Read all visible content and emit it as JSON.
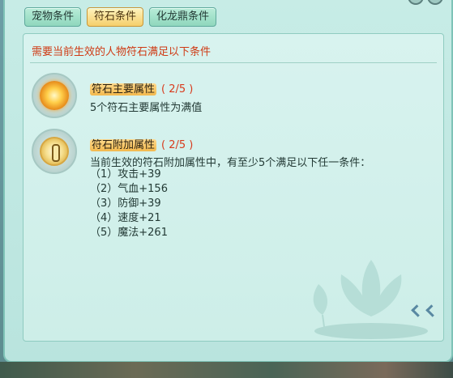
{
  "tabs": [
    {
      "label": "宠物条件",
      "active": false
    },
    {
      "label": "符石条件",
      "active": true
    },
    {
      "label": "化龙鼎条件",
      "active": false
    }
  ],
  "header": {
    "text": "需要当前生效的人物符石满足以下条件"
  },
  "conditions": [
    {
      "icon": "sun-rune-icon",
      "title": "符石主要属性",
      "progress": "( 2/5 )",
      "description": "5个符石主要属性为满值"
    },
    {
      "icon": "shield-rune-icon",
      "title": "符石附加属性",
      "progress": "( 2/5 )",
      "description": "当前生效的符石附加属性中，有至少5个满足以下任一条件：",
      "items": [
        "（1）攻击+39",
        "（2）气血+156",
        "（3）防御+39",
        "（4）速度+21",
        "（5）魔法+261"
      ]
    }
  ],
  "colors": {
    "accent": "#cf3a14",
    "count": "#d83a1c",
    "highlight": "#f3b94e",
    "active_tab": "#f5cf6b"
  }
}
